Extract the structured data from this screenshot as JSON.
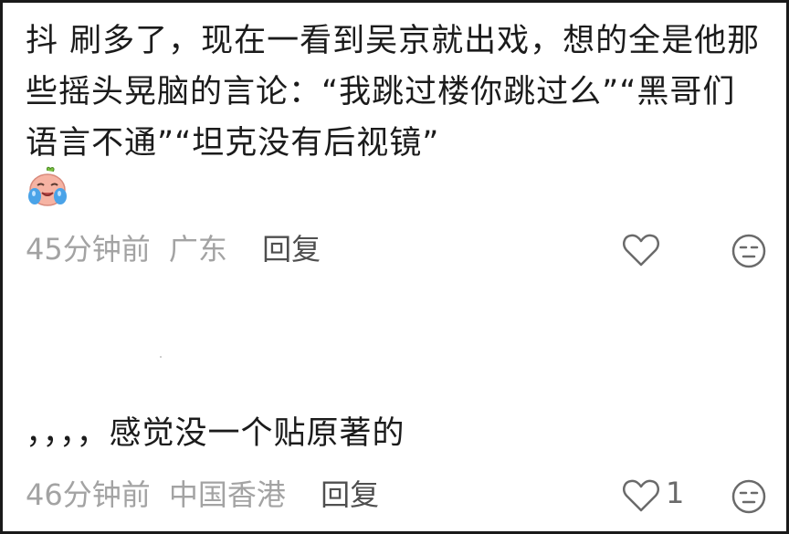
{
  "comments": [
    {
      "text": "抖   刷多了，现在一看到吴京就出戏，想的全是他那些摇头晃脑的言论：“我跳过楼你跳过么”“黑哥们语言不通”“坦克没有后视镜”",
      "emoji": "crying-face-emoji",
      "time": "45分钟前",
      "location": "广东",
      "reply_label": "回复",
      "likes": ""
    },
    {
      "text": "，，，，感觉没一个贴原著的",
      "time": "46分钟前",
      "location": "中国香港",
      "reply_label": "回复",
      "likes": "1"
    }
  ],
  "colors": {
    "text": "#1b1b1b",
    "meta": "#a3a3a3",
    "reply": "#4f4f4f",
    "icon": "#6a6a6a",
    "border": "#1a1a1a"
  }
}
